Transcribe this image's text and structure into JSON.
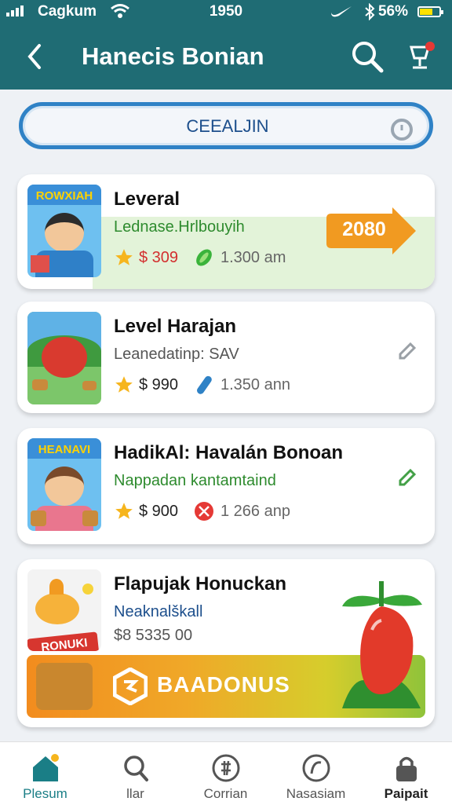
{
  "status_bar": {
    "carrier": "Cagkum",
    "time": "1950",
    "battery": "56%"
  },
  "header": {
    "title": "Hanecis Bonian"
  },
  "search": {
    "placeholder": "CEEALJIN"
  },
  "cards": [
    {
      "thumb_label": "ROWXIAH",
      "title": "Leveral",
      "subtitle": "Lednase.Hrlbouyih",
      "price": "$ 309",
      "duration": "1.300 am",
      "badge": "2080",
      "subtitle_color": "#2e8b2e",
      "price_color": "#d32f2f"
    },
    {
      "title": "Level Harajan",
      "subtitle": "Leanedatinp: SAV",
      "price": "$ 990",
      "duration": "1.350 ann",
      "subtitle_color": "#555555",
      "price_color": "#222222"
    },
    {
      "thumb_label": "HEANAVI",
      "title": "HadikAl: Havalán Bonoan",
      "subtitle": "Nappadan kantamtaind",
      "price": "$ 900",
      "duration": "1 266 anp",
      "subtitle_color": "#2e8b2e",
      "price_color": "#222222"
    },
    {
      "thumb_label": "RONUKI",
      "title": "Flapujak Honuckan",
      "subtitle": "Neaknalškall",
      "price": "$8 5335 00",
      "banner": "BAADONUS",
      "subtitle_color": "#1d4f8c"
    }
  ],
  "tabs": [
    {
      "label": "Plesum",
      "icon": "home-icon",
      "active": true
    },
    {
      "label": "llar",
      "icon": "search-icon"
    },
    {
      "label": "Corrian",
      "icon": "compass-icon"
    },
    {
      "label": "Nasasiam",
      "icon": "profile-icon"
    },
    {
      "label": "Paipait",
      "icon": "lock-icon"
    }
  ],
  "colors": {
    "header_bg": "#1f6c74",
    "accent_blue": "#2f82c6",
    "badge_orange": "#f19a21",
    "star_yellow": "#f6b51d",
    "active_tab": "#1a7e86"
  }
}
